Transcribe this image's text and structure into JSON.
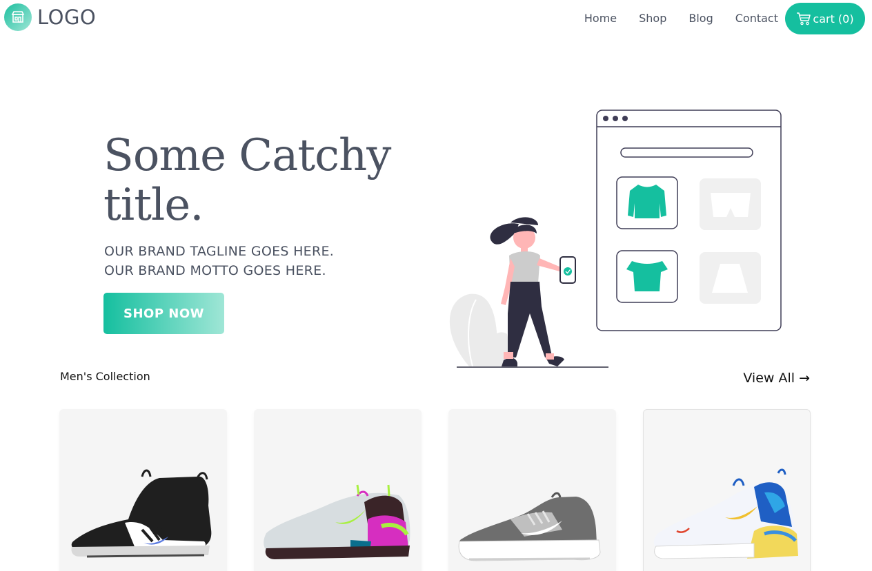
{
  "header": {
    "logo_text": "LOGO",
    "nav": [
      "Home",
      "Shop",
      "Blog",
      "Contact"
    ],
    "cart_label": "cart (0)"
  },
  "hero": {
    "title": "Some Catchy title.",
    "tagline_1": "OUR BRAND TAGLINE GOES HERE.",
    "tagline_2": "OUR BRAND MOTTO GOES HERE.",
    "cta": "SHOP NOW"
  },
  "collection": {
    "title": "Men's Collection",
    "view_all": "View All →",
    "products": [
      {
        "image": "black-white-mid-sneaker"
      },
      {
        "image": "grey-magenta-sneaker"
      },
      {
        "image": "grey-white-sneaker"
      },
      {
        "image": "white-blue-yellow-airmax"
      }
    ]
  },
  "colors": {
    "accent": "#15bf9f",
    "accent_light": "#9fe6d6",
    "text": "#4b5261",
    "card_bg": "#f5f5f5"
  },
  "icons": [
    "storefront-icon",
    "cart-icon"
  ]
}
